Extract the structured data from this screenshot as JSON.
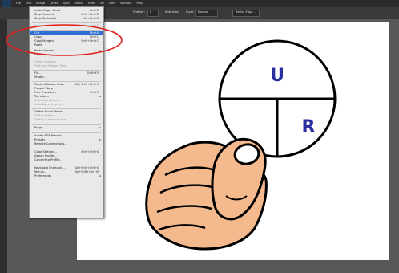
{
  "menubar": {
    "items": [
      "File",
      "Edit",
      "Image",
      "Layer",
      "Type",
      "Select",
      "Filter",
      "3D",
      "View",
      "Window",
      "Help"
    ]
  },
  "options_bar": {
    "feather_label": "Feather:",
    "feather_value": "0",
    "antialias_label": "Anti-alias",
    "style_label": "Style:",
    "style_value": "Normal",
    "refine_edge_label": "Refine Edge..."
  },
  "edit_menu": {
    "items": [
      {
        "label": "Undo Magic Wand",
        "shortcut": "Ctrl+Z",
        "disabled": false
      },
      {
        "label": "Step Forward",
        "shortcut": "Shift+Ctrl+Z",
        "disabled": false
      },
      {
        "label": "Step Backward",
        "shortcut": "Alt+Ctrl+Z",
        "disabled": false
      },
      {
        "label": "Fade...",
        "shortcut": "Shift+Ctrl+F",
        "disabled": true
      },
      {
        "label": "Cut",
        "shortcut": "Ctrl+X",
        "disabled": false,
        "highlighted": true
      },
      {
        "label": "Copy",
        "shortcut": "Ctrl+C",
        "disabled": false
      },
      {
        "label": "Copy Merged",
        "shortcut": "Shift+Ctrl+C",
        "disabled": false
      },
      {
        "label": "Paste",
        "shortcut": "",
        "disabled": false
      },
      {
        "label": "Paste Special",
        "shortcut": "",
        "disabled": false,
        "submenu": true
      },
      {
        "label": "Clear",
        "shortcut": "",
        "disabled": false
      },
      {
        "label": "Check Spelling...",
        "shortcut": "",
        "disabled": true
      },
      {
        "label": "Find and Replace Text...",
        "shortcut": "",
        "disabled": true
      },
      {
        "label": "Fill...",
        "shortcut": "Shift+F5",
        "disabled": false
      },
      {
        "label": "Stroke...",
        "shortcut": "",
        "disabled": false
      },
      {
        "label": "Content-Aware Scale",
        "shortcut": "Alt+Shift+Ctrl+C",
        "disabled": false
      },
      {
        "label": "Puppet Warp",
        "shortcut": "",
        "disabled": false
      },
      {
        "label": "Free Transform",
        "shortcut": "Ctrl+T",
        "disabled": false
      },
      {
        "label": "Transform",
        "shortcut": "",
        "disabled": false,
        "submenu": true
      },
      {
        "label": "Auto-Align Layers...",
        "shortcut": "",
        "disabled": true
      },
      {
        "label": "Auto-Blend Layers...",
        "shortcut": "",
        "disabled": true
      },
      {
        "label": "Define Brush Preset...",
        "shortcut": "",
        "disabled": false
      },
      {
        "label": "Define Pattern...",
        "shortcut": "",
        "disabled": true
      },
      {
        "label": "Define Custom Shape...",
        "shortcut": "",
        "disabled": true
      },
      {
        "label": "Purge",
        "shortcut": "",
        "disabled": false,
        "submenu": true
      },
      {
        "label": "Adobe PDF Presets...",
        "shortcut": "",
        "disabled": false
      },
      {
        "label": "Presets",
        "shortcut": "",
        "disabled": false,
        "submenu": true
      },
      {
        "label": "Remote Connections...",
        "shortcut": "",
        "disabled": false
      },
      {
        "label": "Color Settings...",
        "shortcut": "Shift+Ctrl+K",
        "disabled": false
      },
      {
        "label": "Assign Profile...",
        "shortcut": "",
        "disabled": false
      },
      {
        "label": "Convert to Profile...",
        "shortcut": "",
        "disabled": false
      },
      {
        "label": "Keyboard Shortcuts...",
        "shortcut": "Alt+Shift+Ctrl+K",
        "disabled": false
      },
      {
        "label": "Menus...",
        "shortcut": "Alt+Shift+Ctrl+M",
        "disabled": false
      },
      {
        "label": "Preferences",
        "shortcut": "",
        "disabled": false,
        "submenu": true
      }
    ]
  },
  "artwork": {
    "circle_top_label": "U",
    "circle_right_label": "R",
    "label_color": "#2a2fa0",
    "skin_color": "#f4b98c"
  },
  "annotation": {
    "ellipse_color": "#e0201c"
  }
}
